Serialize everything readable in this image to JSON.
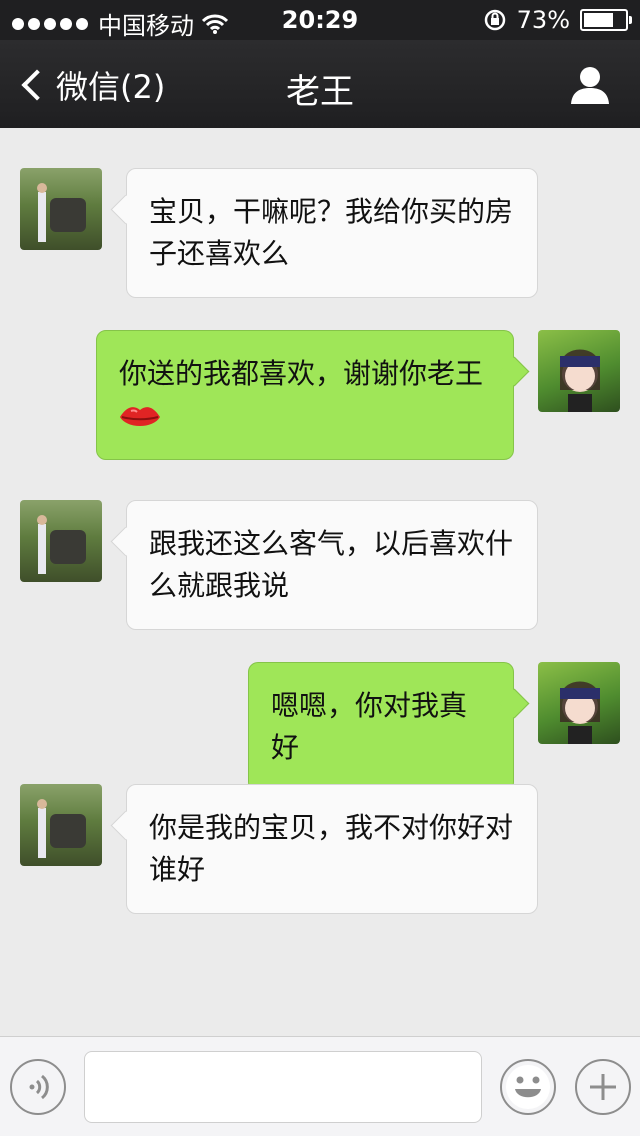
{
  "status_bar": {
    "carrier": "中国移动",
    "time": "20:29",
    "battery": "73%",
    "battery_level": 0.73
  },
  "nav": {
    "back_label": "微信(2)",
    "title": "老王"
  },
  "messages": [
    {
      "side": "left",
      "text": "宝贝，干嘛呢？我给你买的房子还喜欢么"
    },
    {
      "side": "right",
      "text": "你送的我都喜欢，谢谢你老王",
      "emoji": "lips"
    },
    {
      "side": "left",
      "text": "跟我还这么客气，以后喜欢什么就跟我说"
    },
    {
      "side": "right",
      "text": "嗯嗯，你对我真好"
    },
    {
      "side": "left",
      "text": "你是我的宝贝，我不对你好对谁好"
    }
  ],
  "input_bar": {
    "input_value": "",
    "icons": [
      "voice-icon",
      "emoji-icon",
      "plus-icon"
    ]
  }
}
